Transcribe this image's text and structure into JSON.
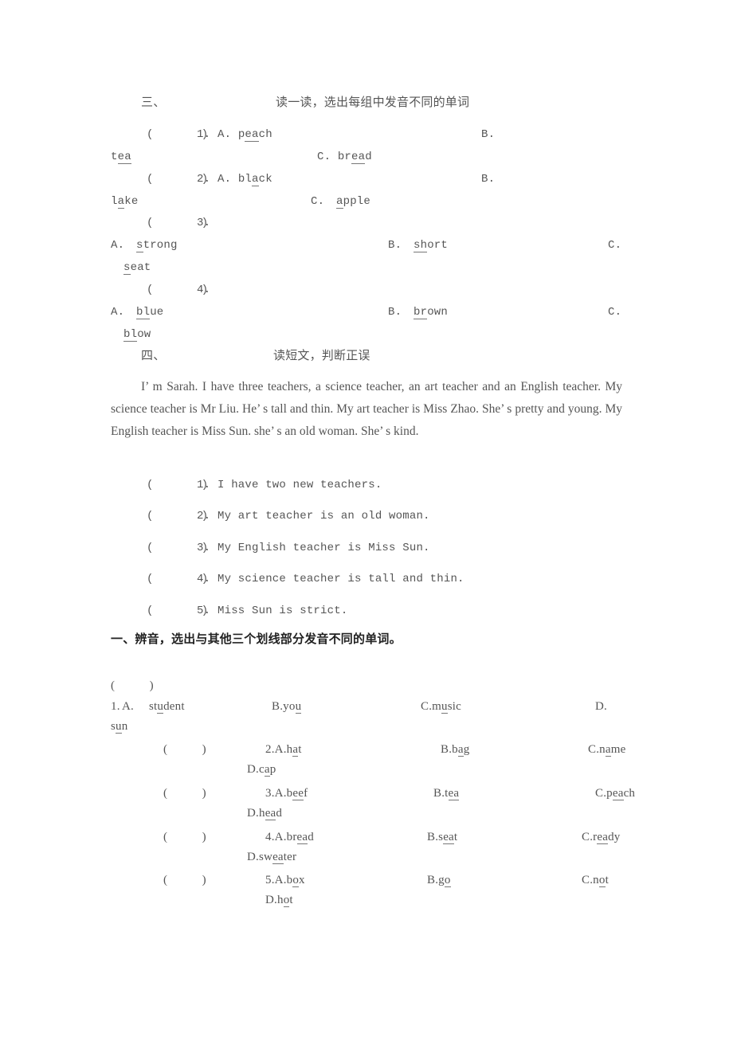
{
  "section3": {
    "number": "三、",
    "title": "读一读，选出每组中发音不同的单词",
    "questions": [
      {
        "paren": "(       )",
        "num": "1.",
        "options": [
          {
            "label": "A.",
            "pre": "p",
            "u": "ea",
            "post": "ch"
          },
          {
            "label": "B.",
            "pre": "t",
            "u": "ea",
            "post": ""
          },
          {
            "label": "C.",
            "pre": "br",
            "u": "ea",
            "post": "d"
          }
        ]
      },
      {
        "paren": "(       )",
        "num": "2.",
        "options": [
          {
            "label": "A.",
            "pre": "bl",
            "u": "a",
            "post": "ck"
          },
          {
            "label": "B.",
            "pre": "l",
            "u": "a",
            "post": "ke"
          },
          {
            "label": "C.",
            "pre": "",
            "u": "a",
            "post": "pple"
          }
        ]
      },
      {
        "paren": "(       )",
        "num": "3.",
        "options": [
          {
            "label": "A.",
            "pre": "",
            "u": "s",
            "post": "trong"
          },
          {
            "label": "B.",
            "pre": "",
            "u": "sh",
            "post": "ort"
          },
          {
            "label": "C.",
            "pre": "",
            "u": "s",
            "post": "eat"
          }
        ]
      },
      {
        "paren": "(       )",
        "num": "4.",
        "options": [
          {
            "label": "A.",
            "pre": "",
            "u": "bl",
            "post": "ue"
          },
          {
            "label": "B.",
            "pre": "",
            "u": "br",
            "post": "own"
          },
          {
            "label": "C.",
            "pre": "",
            "u": "bl",
            "post": "ow"
          }
        ]
      }
    ]
  },
  "section4": {
    "number": "四、",
    "title": "读短文，判断正误",
    "passage": "I’ m Sarah. I have three teachers, a science teacher, an art teacher and an English teacher. My science teacher is Mr Liu. He’ s tall and thin. My art teacher is Miss Zhao. She’ s pretty and young. My English teacher is Miss Sun. she’ s an old woman. She’ s kind.",
    "statements": [
      {
        "paren": "(       )",
        "num": "1.",
        "text": "I have two new teachers."
      },
      {
        "paren": "(       )",
        "num": "2.",
        "text": "My art teacher is an old woman."
      },
      {
        "paren": "(       )",
        "num": "3.",
        "text": "My English teacher is Miss Sun."
      },
      {
        "paren": "(       )",
        "num": "4.",
        "text": "My science teacher is tall and thin."
      },
      {
        "paren": "(       )",
        "num": "5.",
        "text": "Miss Sun is strict."
      }
    ]
  },
  "section1": {
    "title": "一、辨音，选出与其他三个划线部分发音不同的单词。",
    "questions": [
      {
        "paren": "(           )",
        "num": "1.",
        "options": [
          {
            "label": "A.",
            "pre": "st",
            "u": "u",
            "post": "dent"
          },
          {
            "label": "B.",
            "pre": "yo",
            "u": "u",
            "post": ""
          },
          {
            "label": "C.",
            "pre": "m",
            "u": "u",
            "post": "sic"
          },
          {
            "label": "D.",
            "pre": "s",
            "u": "u",
            "post": "n"
          }
        ]
      },
      {
        "paren": "(           )",
        "num": "2.",
        "options": [
          {
            "label": "A.",
            "pre": "h",
            "u": "a",
            "post": "t"
          },
          {
            "label": "B.",
            "pre": "b",
            "u": "a",
            "post": "g"
          },
          {
            "label": "C.",
            "pre": "n",
            "u": "a",
            "post": "me"
          },
          {
            "label": "D.",
            "pre": "c",
            "u": "a",
            "post": "p"
          }
        ]
      },
      {
        "paren": "(           )",
        "num": "3.",
        "options": [
          {
            "label": "A.",
            "pre": "b",
            "u": "ee",
            "post": "f"
          },
          {
            "label": "B.",
            "pre": "t",
            "u": "ea",
            "post": ""
          },
          {
            "label": "C.",
            "pre": "p",
            "u": "ea",
            "post": "ch"
          },
          {
            "label": "D.",
            "pre": "h",
            "u": "ea",
            "post": "d"
          }
        ]
      },
      {
        "paren": "(           )",
        "num": "4.",
        "options": [
          {
            "label": "A.",
            "pre": "br",
            "u": "ea",
            "post": "d"
          },
          {
            "label": "B.",
            "pre": "s",
            "u": "ea",
            "post": "t"
          },
          {
            "label": "C.",
            "pre": "r",
            "u": "ea",
            "post": "dy"
          },
          {
            "label": "D.",
            "pre": "sw",
            "u": "ea",
            "post": "ter"
          }
        ]
      },
      {
        "paren": "(           )",
        "num": "5.",
        "options": [
          {
            "label": "A.",
            "pre": "b",
            "u": "o",
            "post": "x"
          },
          {
            "label": "B.",
            "pre": "g",
            "u": "o",
            "post": ""
          },
          {
            "label": "C.",
            "pre": "n",
            "u": "o",
            "post": "t"
          },
          {
            "label": "D.",
            "pre": "h",
            "u": "o",
            "post": "t"
          }
        ]
      }
    ]
  }
}
